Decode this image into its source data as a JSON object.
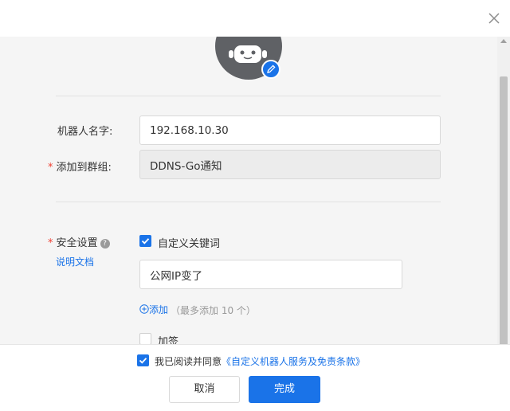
{
  "dialog": {
    "close_icon": "close-icon"
  },
  "avatar": {
    "icon": "robot-avatar-icon",
    "edit_icon": "pencil-icon"
  },
  "form": {
    "robot_name": {
      "label": "机器人名字:",
      "value": "192.168.10.30"
    },
    "group": {
      "required_mark": "*",
      "label": "添加到群组:",
      "value": "DDNS-Go通知"
    },
    "security": {
      "required_mark": "*",
      "label": "安全设置",
      "help_icon": "question-circle-icon",
      "doc_link": "说明文档",
      "keyword_option": {
        "label": "自定义关键词",
        "checked": true
      },
      "keyword_value": "公网IP变了",
      "add_icon": "plus-circle-icon",
      "add_label": "添加",
      "add_hint": "（最多添加 10 个）",
      "sign_option": {
        "label": "加签",
        "checked": false
      }
    }
  },
  "footer": {
    "agree_checked": true,
    "agree_prefix": "我已阅读并同意",
    "agree_link": "《自定义机器人服务及免责条款》",
    "cancel_label": "取消",
    "confirm_label": "完成"
  },
  "colors": {
    "accent": "#1a73e8",
    "required": "#f04134",
    "avatar_bg": "#5f6165"
  }
}
